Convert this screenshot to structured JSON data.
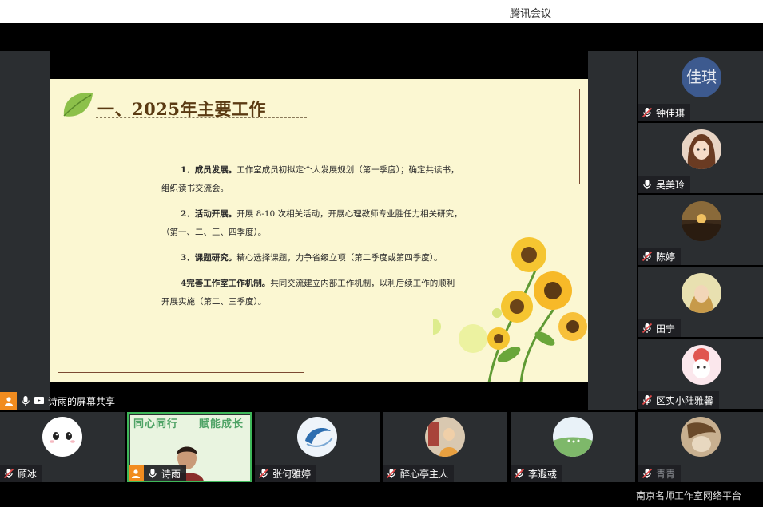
{
  "window": {
    "title": "腾讯会议"
  },
  "slide": {
    "heading": "一、2025年主要工作",
    "items": [
      {
        "label": "1．成员发展。",
        "text": "工作室成员初拟定个人发展规划（第一季度）；确定共读书，",
        "cont": "组织读书交流会。"
      },
      {
        "label": "2．活动开展。",
        "text": "开展 8-10 次相关活动，开展心理教师专业胜任力相关研究，",
        "cont": "（第一、二、三、四季度）。"
      },
      {
        "label": "3．课题研究。",
        "text": "精心选择课题，力争省级立项（第二季度或第四季度）。",
        "cont": ""
      },
      {
        "label": "4完善工作室工作机制。",
        "text": "共同交流建立内部工作机制，以利后续工作的顺利",
        "cont": "开展实施（第二、三季度）。"
      }
    ]
  },
  "share_bar": {
    "label": "诗雨的屏幕共享"
  },
  "participants_side": [
    {
      "name": "钟佳琪",
      "avatar_text": "佳琪",
      "mic": "muted"
    },
    {
      "name": "吴美玲",
      "mic": "on"
    },
    {
      "name": "陈婷",
      "mic": "muted"
    },
    {
      "name": "田宁",
      "mic": "muted"
    },
    {
      "name": "区实小陆雅馨",
      "mic": "muted"
    }
  ],
  "participants_bottom": [
    {
      "name": "顾冰",
      "mic": "muted"
    },
    {
      "name": "诗雨",
      "mic": "on",
      "video_text_left": "同心同行",
      "video_text_right": "赋能成长"
    },
    {
      "name": "张何雅婷",
      "mic": "muted"
    },
    {
      "name": "醉心亭主人",
      "mic": "muted"
    },
    {
      "name": "李遐彧",
      "mic": "muted"
    },
    {
      "name": "青青",
      "mic": "muted"
    }
  ],
  "footer": {
    "watermark": "南京名师工作室网络平台"
  },
  "colors": {
    "active_border": "#3fb85a",
    "host_badge": "#f18c1f",
    "mute_red": "#e04848"
  }
}
